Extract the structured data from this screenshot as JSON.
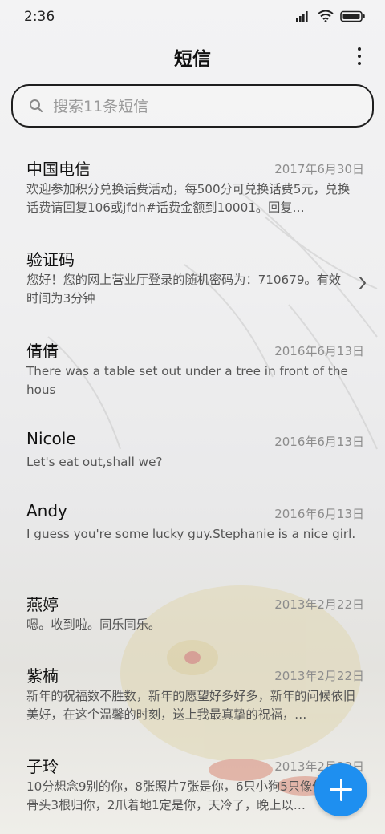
{
  "status_bar": {
    "time": "2:36"
  },
  "header": {
    "title": "短信"
  },
  "search": {
    "placeholder": "搜索11条短信"
  },
  "messages": [
    {
      "name": "中国电信",
      "date": "2017年6月30日",
      "preview": "欢迎参加积分兑换话费活动，每500分可兑换话费5元，兑换话费请回复106或jfdh#话费金额到10001。回复…"
    },
    {
      "name": "验证码",
      "date": "",
      "preview": "您好！您的网上营业厅登录的随机密码为：710679。有效时间为3分钟"
    },
    {
      "name": "倩倩",
      "date": "2016年6月13日",
      "preview": "There was a table set out under a tree in front of the hous"
    },
    {
      "name": "Nicole",
      "date": "2016年6月13日",
      "preview": "Let's eat out,shall we?"
    },
    {
      "name": "Andy",
      "date": "2016年6月13日",
      "preview": "I guess you're some lucky guy.Stephanie is a nice girl."
    },
    {
      "name": "燕婷",
      "date": "2013年2月22日",
      "preview": "嗯。收到啦。同乐同乐。"
    },
    {
      "name": "紫楠",
      "date": "2013年2月22日",
      "preview": "新年的祝福数不胜数，新年的愿望好多好多，新年的问候依旧美好，在这个温馨的时刻，送上我最真挚的祝福，…"
    },
    {
      "name": "子玲",
      "date": "2013年2月22日",
      "preview": "10分想念9别的你，8张照片7张是你，6只小狗5只像你，4根骨头3根归你，2爪着地1定是你，天冷了，晚上以…"
    }
  ],
  "icons": [
    "signal-icon",
    "wifi-icon",
    "battery-icon",
    "more-icon",
    "search-icon",
    "chevron-right-icon",
    "plus-icon"
  ],
  "colors": {
    "fab": "#1e8ff0",
    "text": "#111111",
    "secondary": "#8c8c8c"
  }
}
